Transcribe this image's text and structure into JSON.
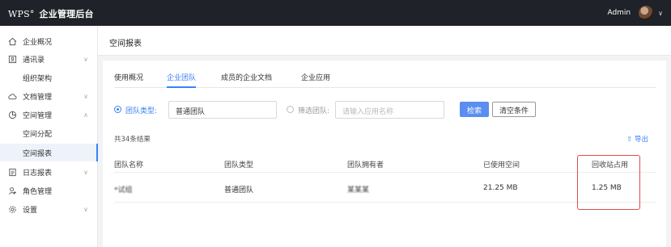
{
  "app": {
    "logo": "WPS°",
    "title": "企业管理后台"
  },
  "user": {
    "name": "Admin"
  },
  "sidebar": {
    "items": [
      {
        "label": "企业概况",
        "icon": "home-icon"
      },
      {
        "label": "通讯录",
        "icon": "contacts-icon"
      },
      {
        "label": "组织架构",
        "icon": ""
      },
      {
        "label": "文档管理",
        "icon": "cloud-icon"
      },
      {
        "label": "空间管理",
        "icon": "pie-chart-icon"
      },
      {
        "label": "空间分配",
        "icon": ""
      },
      {
        "label": "空间报表",
        "icon": ""
      },
      {
        "label": "日志报表",
        "icon": "log-icon"
      },
      {
        "label": "角色管理",
        "icon": "user-role-icon"
      },
      {
        "label": "设置",
        "icon": "gear-icon"
      }
    ]
  },
  "page": {
    "title": "空间报表"
  },
  "tabs": [
    {
      "label": "使用概况"
    },
    {
      "label": "企业团队"
    },
    {
      "label": "成员的企业文档"
    },
    {
      "label": "企业应用"
    }
  ],
  "filters": {
    "team_type_label": "团队类型:",
    "team_type_value": "普通团队",
    "filter_team_label": "筛选团队:",
    "filter_team_placeholder": "请输入应用名称",
    "search_button": "检索",
    "clear_button": "清空条件"
  },
  "results": {
    "total": "共34条结果",
    "export": "导出"
  },
  "table": {
    "headers": [
      "团队名称",
      "团队类型",
      "团队拥有者",
      "已使用空间",
      "回收站占用"
    ],
    "rows": [
      {
        "name": "*试组",
        "type": "普通团队",
        "owner": "某某某",
        "used": "21.25 MB",
        "recycle": "1.25 MB"
      }
    ]
  },
  "colors": {
    "accent": "#3b82f6",
    "highlight": "#e04b4b",
    "topbar": "#1f2228"
  }
}
